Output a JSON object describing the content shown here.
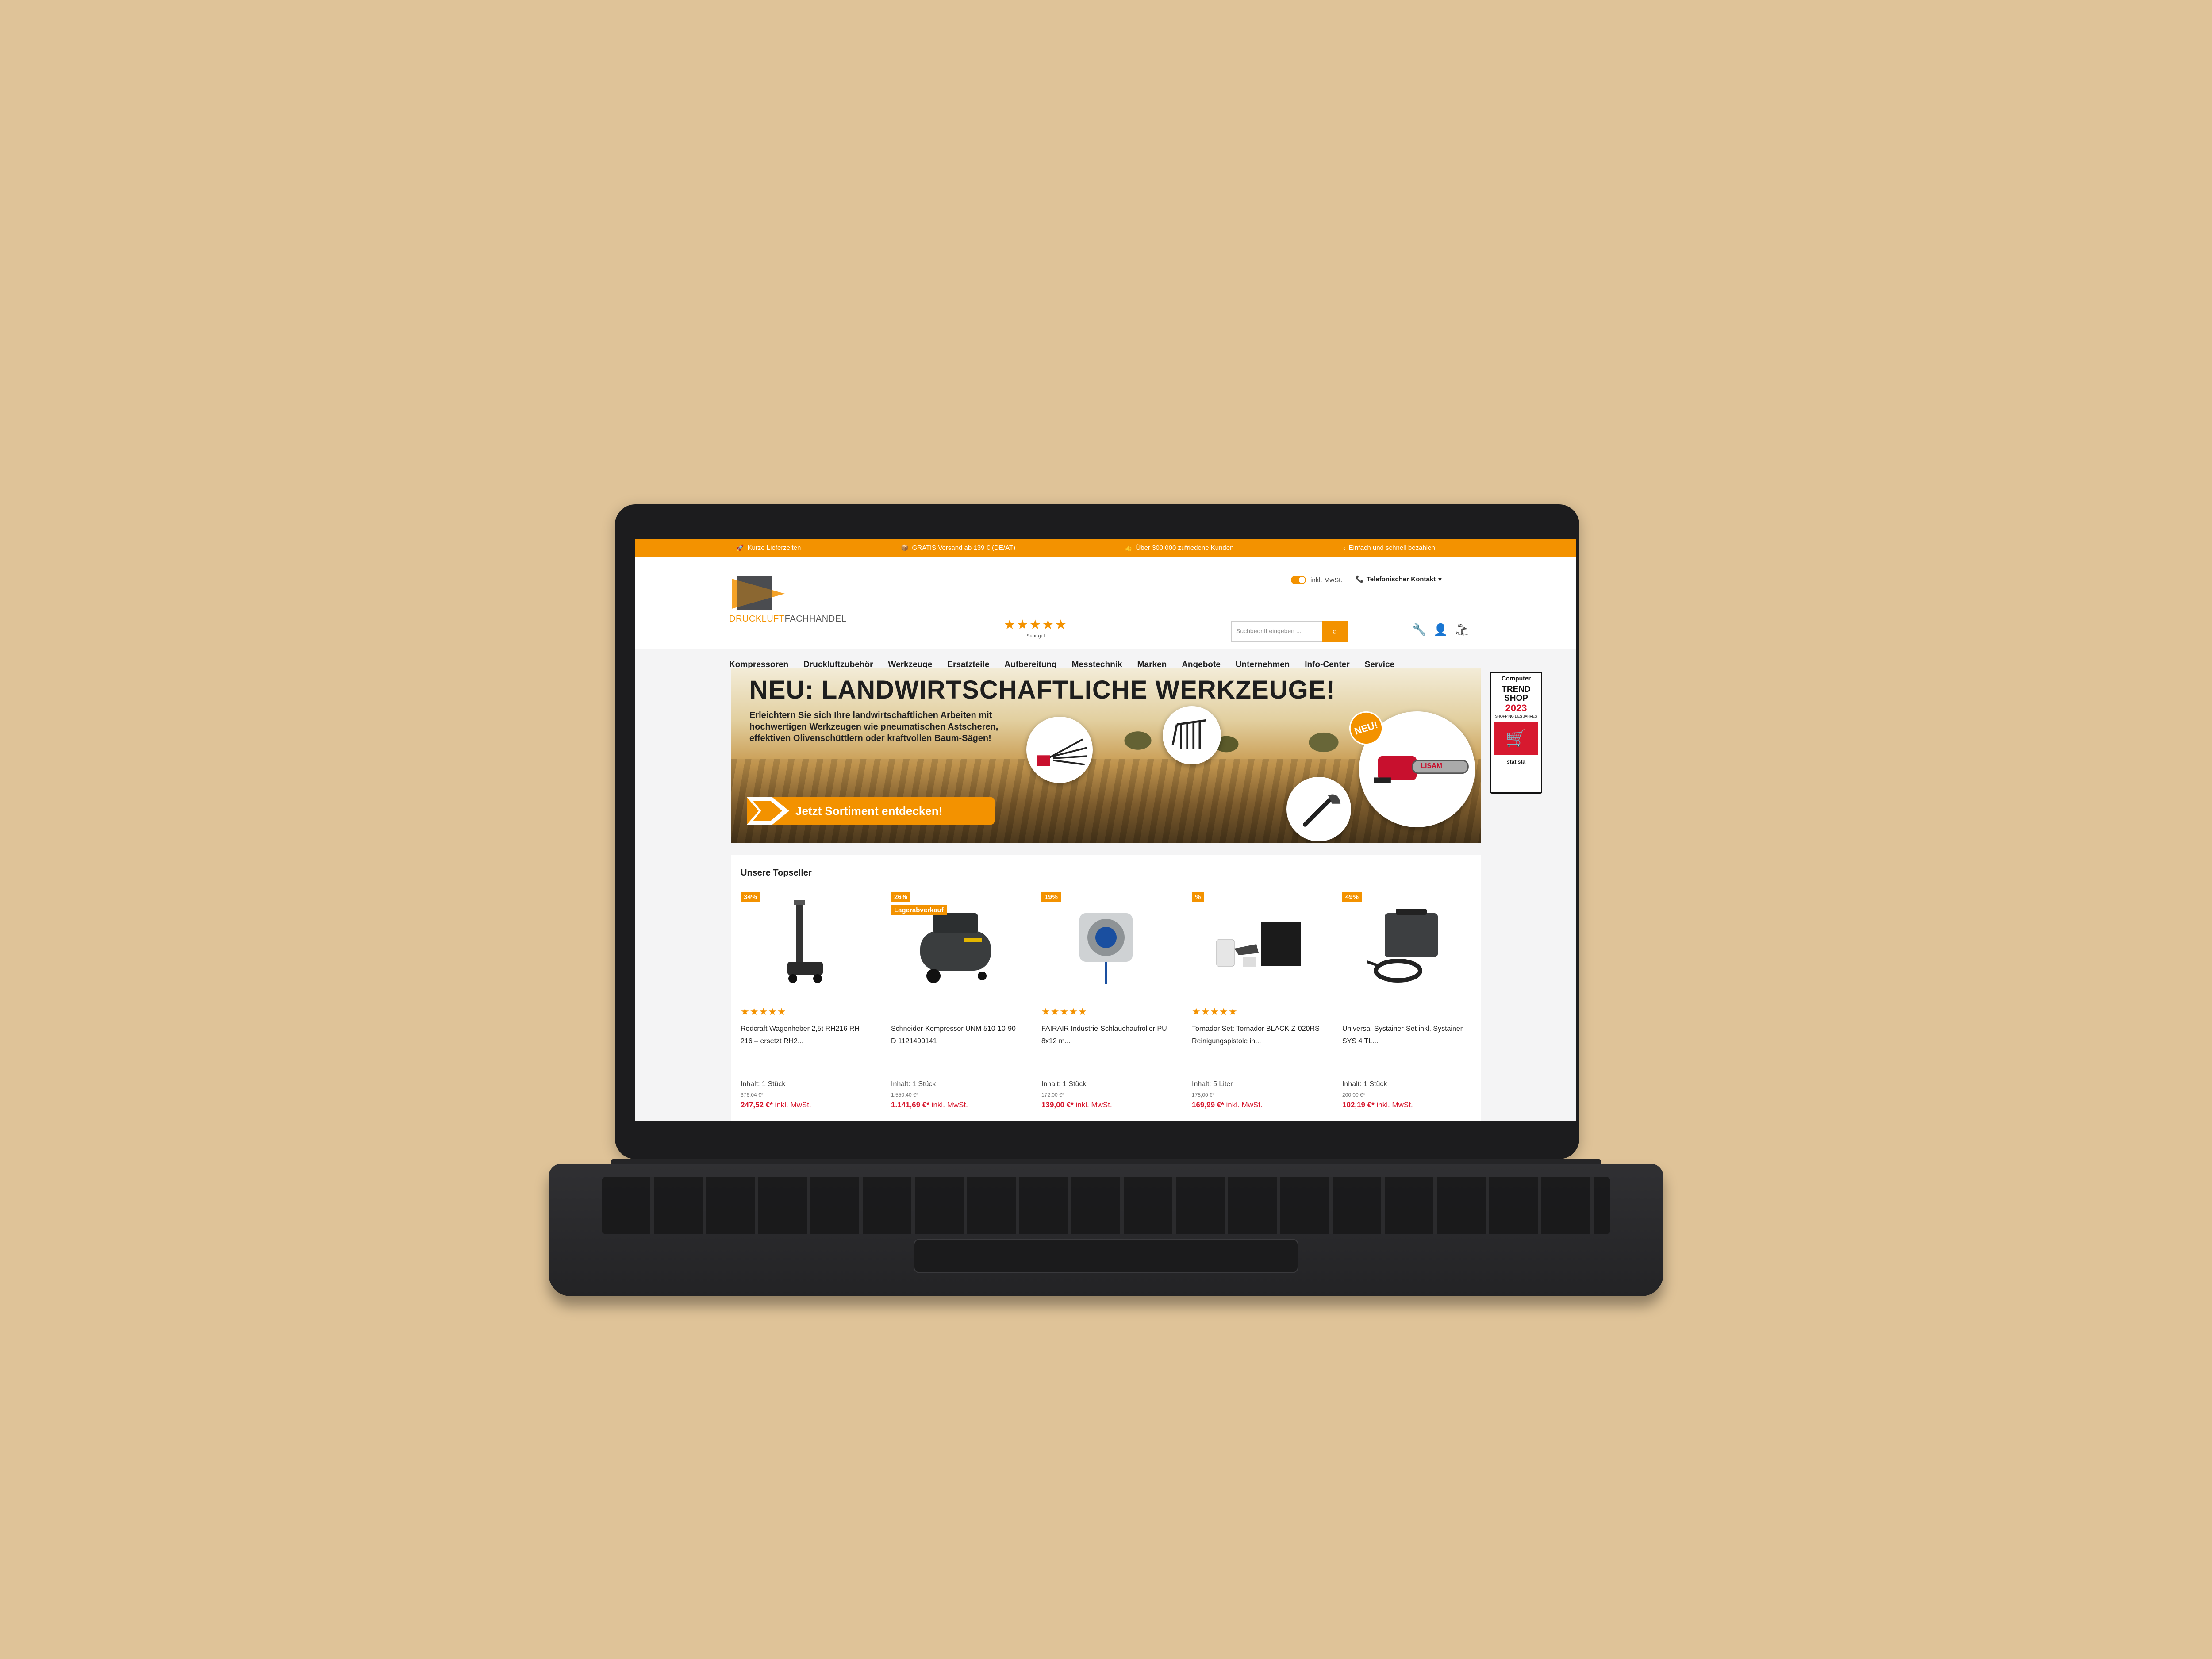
{
  "topbar": {
    "usps": [
      {
        "icon": "rocket-icon",
        "glyph": "🚀",
        "text": "Kurze Lieferzeiten"
      },
      {
        "icon": "box-icon",
        "glyph": "📦",
        "text": "GRATIS Versand ab 139 € (DE/AT)"
      },
      {
        "icon": "thumb-icon",
        "glyph": "👍",
        "text": "Über 300.000 zufriedene Kunden"
      },
      {
        "icon": "chevron-icon",
        "glyph": "‹",
        "text": "Einfach und schnell bezahlen"
      }
    ]
  },
  "header": {
    "logo": {
      "part1": "DRUCKLUFT",
      "part2": "FACHHANDEL"
    },
    "tax_toggle_label": "inkl. MwSt.",
    "phone_label": "Telefonischer Kontakt",
    "rating": {
      "stars": "★★★★★",
      "text": "Sehr gut"
    },
    "search_placeholder": "Suchbegriff eingeben ...",
    "icons": [
      "wrench-icon",
      "user-icon",
      "cart-icon"
    ]
  },
  "nav": [
    "Kompressoren",
    "Druckluftzubehör",
    "Werkzeuge",
    "Ersatzteile",
    "Aufbereitung",
    "Messtechnik",
    "Marken",
    "Angebote",
    "Unternehmen",
    "Info-Center",
    "Service"
  ],
  "hero": {
    "title": "NEU: LANDWIRTSCHAFTLICHE WERKZEUGE!",
    "text": "Erleichtern Sie sich Ihre landwirtschaftlichen Arbeiten mit hochwertigen Werkzeugen wie pneumatischen Astscheren, effektiven Olivenschüttlern oder kraftvollen Baum-Sägen!",
    "cta": "Jetzt Sortiment entdecken!",
    "badge": "NEU!"
  },
  "trend_badge": {
    "brand": "Computer",
    "line1": "TREND",
    "line2": "SHOP",
    "year": "2023",
    "sub": "SHOPPING DES JAHRES",
    "source": "statista"
  },
  "topseller": {
    "title": "Unsere Topseller",
    "products": [
      {
        "badge": "34%",
        "badge2": "",
        "stars": "★★★★★",
        "name": "Rodcraft Wagenheber 2,5t RH216 RH 216 – ersetzt RH2...",
        "content": "Inhalt: 1 Stück",
        "old_price": "376,04 €*",
        "price": "247,52 €*",
        "tax": "inkl. MwSt."
      },
      {
        "badge": "26%",
        "badge2": "Lagerabverkauf",
        "stars": "",
        "name": "Schneider-Kompressor UNM 510-10-90 D 1121490141",
        "content": "Inhalt: 1 Stück",
        "old_price": "1.550,40 €*",
        "price": "1.141,69 €*",
        "tax": "inkl. MwSt."
      },
      {
        "badge": "19%",
        "badge2": "",
        "stars": "★★★★★",
        "name": "FAIRAIR Industrie-Schlauchaufroller PU 8x12 m...",
        "content": "Inhalt: 1 Stück",
        "old_price": "172,00 €*",
        "price": "139,00 €*",
        "tax": "inkl. MwSt."
      },
      {
        "badge": "%",
        "badge2": "",
        "stars": "★★★★★",
        "name": "Tornador Set: Tornador BLACK Z-020RS Reinigungspistole in...",
        "content": "Inhalt: 5 Liter",
        "old_price": "178,00 €*",
        "price": "169,99 €*",
        "tax": "inkl. MwSt."
      },
      {
        "badge": "49%",
        "badge2": "",
        "stars": "",
        "name": "Universal-Systainer-Set inkl. Systainer SYS 4 TL...",
        "content": "Inhalt: 1 Stück",
        "old_price": "200,00 €*",
        "price": "102,19 €*",
        "tax": "inkl. MwSt."
      }
    ]
  },
  "colors": {
    "accent": "#f39200",
    "price": "#d7192f",
    "background": "#dfc398"
  }
}
